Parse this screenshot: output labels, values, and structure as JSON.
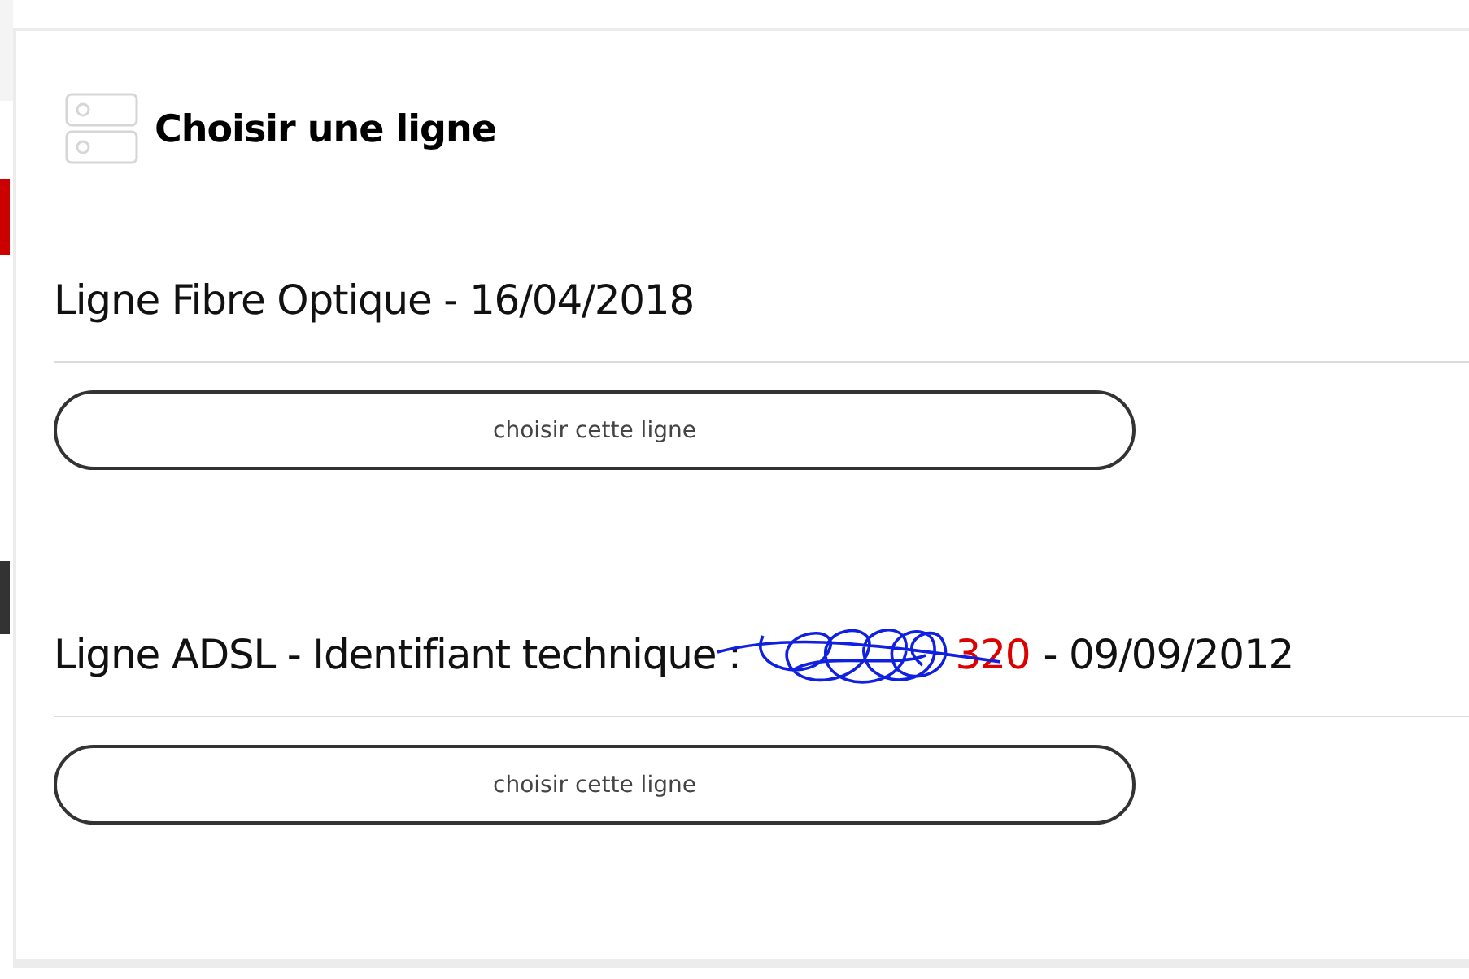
{
  "header": {
    "title": "Choisir une ligne"
  },
  "lines": [
    {
      "kind": "plain",
      "title": "Ligne Fibre Optique - 16/04/2018",
      "button": "choisir cette ligne"
    },
    {
      "kind": "identified",
      "title_prefix": "Ligne ADSL - Identifiant technique :",
      "identifier": "320",
      "redacted": true,
      "title_suffix": "- 09/09/2012",
      "button": "choisir cette ligne"
    }
  ]
}
